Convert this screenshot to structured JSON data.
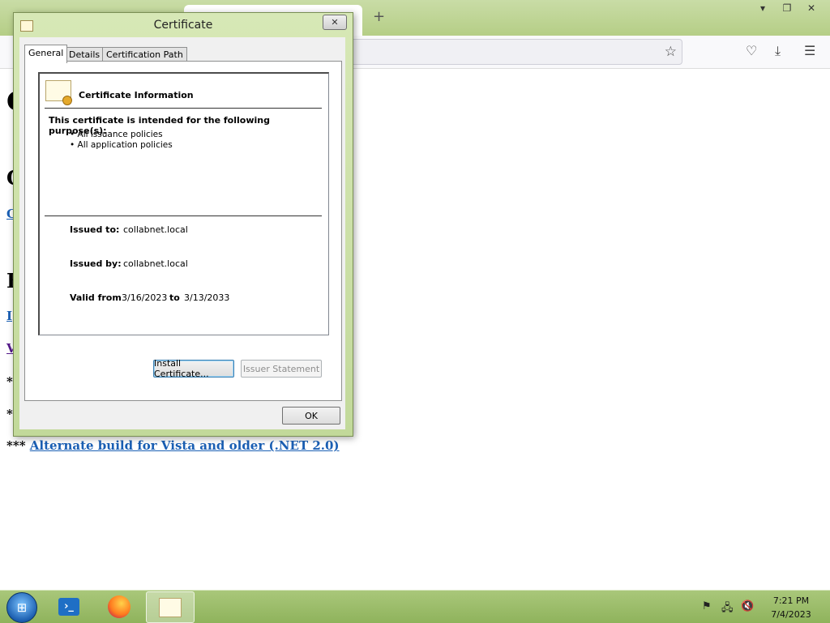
{
  "browser": {
    "window_controls": [
      "▾",
      "❐",
      "✕"
    ],
    "newtab_label": "+",
    "page": {
      "headings": [
        "C",
        "C",
        "B"
      ],
      "links": [
        "C",
        "I",
        "V"
      ],
      "bullets": [
        "*",
        "*"
      ],
      "last_line_prefix": "***",
      "last_link": "Alternate build for Vista and older (.NET 2.0)"
    }
  },
  "dialog": {
    "title": "Certificate",
    "close_label": "✕",
    "tabs": [
      "General",
      "Details",
      "Certification Path"
    ],
    "info_title": "Certificate Information",
    "purpose_title": "This certificate is intended for the following purpose(s):",
    "purposes": [
      "• All issuance policies",
      "• All application policies"
    ],
    "issued_to_label": "Issued to:",
    "issued_to_value": "collabnet.local",
    "issued_by_label": "Issued by:",
    "issued_by_value": "collabnet.local",
    "valid_from_label": "Valid from",
    "valid_from_value": "3/16/2023",
    "valid_to_label": "to",
    "valid_to_value": "3/13/2033",
    "install_button": "Install Certificate...",
    "issuer_button": "Issuer Statement",
    "ok_button": "OK"
  },
  "taskbar": {
    "time": "7:21 PM",
    "date": "7/4/2023"
  }
}
